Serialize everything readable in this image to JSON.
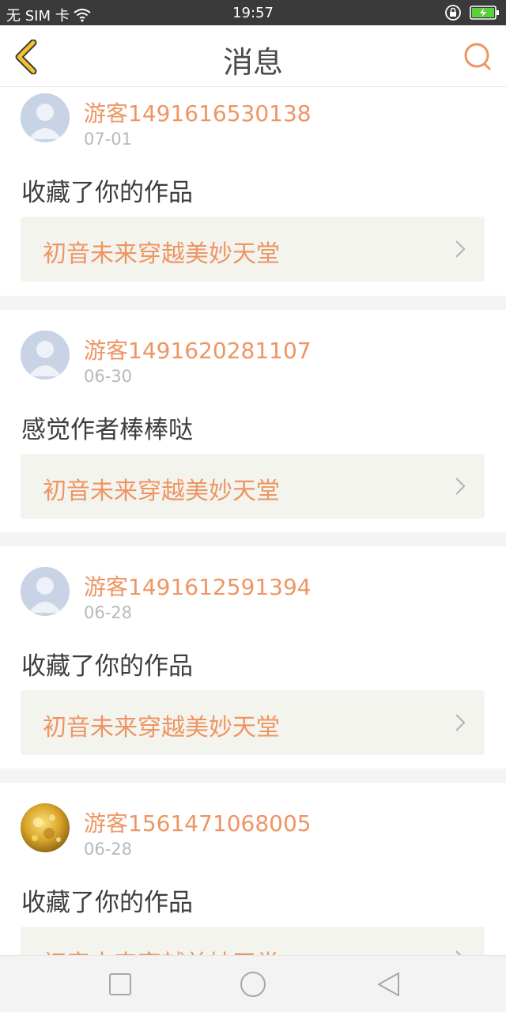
{
  "status_bar": {
    "carrier": "无 SIM 卡",
    "time": "19:57",
    "icons": [
      "wifi-icon",
      "rotation-lock-icon",
      "battery-charging-icon"
    ]
  },
  "header": {
    "title": "消息",
    "back_icon": "chevron-left-icon",
    "search_icon": "search-icon"
  },
  "messages": [
    {
      "username": "游客1491616530138",
      "date": "07-01",
      "action": "收藏了你的作品",
      "work_title": "初音未来穿越美妙天堂",
      "avatar": "default-avatar"
    },
    {
      "username": "游客1491620281107",
      "date": "06-30",
      "action": "感觉作者棒棒哒",
      "work_title": "初音未来穿越美妙天堂",
      "avatar": "default-avatar"
    },
    {
      "username": "游客1491612591394",
      "date": "06-28",
      "action": "收藏了你的作品",
      "work_title": "初音未来穿越美妙天堂",
      "avatar": "default-avatar"
    },
    {
      "username": "游客1561471068005",
      "date": "06-28",
      "action": "收藏了你的作品",
      "work_title": "初音未来穿越美妙天堂",
      "avatar": "photo-avatar"
    }
  ],
  "nav_bar": {
    "icons": [
      "recent-apps-icon",
      "home-icon",
      "back-triangle-icon"
    ]
  },
  "colors": {
    "accent": "#ee9563",
    "back_arrow": "#f2c230",
    "link_background": "#f4f4ee",
    "separator": "#f4f4f4"
  }
}
